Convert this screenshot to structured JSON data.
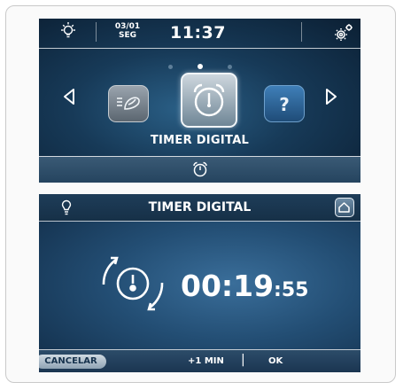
{
  "screen_top": {
    "date_line1": "03/01",
    "date_line2": "SEG",
    "time": "11:37",
    "carousel_label": "TIMER DIGITAL",
    "carousel_items": [
      "recipe-icon",
      "alarm-clock-icon",
      "help-icon"
    ],
    "page_dots": 3,
    "active_dot": 1
  },
  "screen_bottom": {
    "title": "TIMER DIGITAL",
    "timer_hm": "00:19",
    "timer_sec": ":55",
    "cancel_label": "CANCELAR",
    "plus_label": "+1 MIN",
    "separator": "|",
    "ok_label": "OK"
  },
  "colors": {
    "panel_dark": "#173a58",
    "panel_light": "#2a5f86",
    "text": "#ffffff",
    "cancel_bg": "#b9c8d4"
  }
}
